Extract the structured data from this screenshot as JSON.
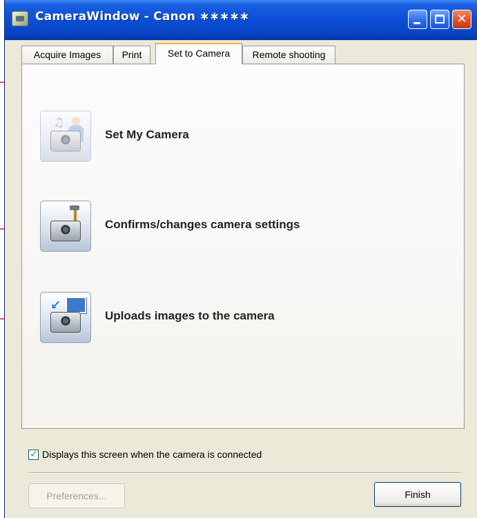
{
  "window": {
    "title": "CameraWindow - Canon ∗∗∗∗∗",
    "controls": {
      "minimize": "minimize",
      "maximize": "maximize",
      "close": "✕"
    }
  },
  "tabs": [
    {
      "label": "Acquire Images",
      "active": false
    },
    {
      "label": "Print",
      "active": false
    },
    {
      "label": "Set to Camera",
      "active": true
    },
    {
      "label": "Remote shooting",
      "active": false
    }
  ],
  "options": [
    {
      "label": "Set My Camera",
      "icon": "set-my-camera-icon",
      "enabled": false
    },
    {
      "label": "Confirms/changes camera settings",
      "icon": "camera-settings-icon",
      "enabled": true
    },
    {
      "label": "Uploads images to the camera",
      "icon": "upload-images-icon",
      "enabled": true
    }
  ],
  "icons": {
    "note": "♫",
    "arrow": "↙",
    "check": "✓"
  },
  "startup_checkbox": {
    "label": "Displays this screen when the camera is connected",
    "checked": true
  },
  "buttons": {
    "preferences": "Preferences...",
    "finish": "Finish"
  },
  "colors": {
    "title_bar": "#0a4fd6",
    "active_tab_accent": "#f7b335",
    "callout_line": "#d8566a",
    "window_bg": "#ece9d8"
  }
}
